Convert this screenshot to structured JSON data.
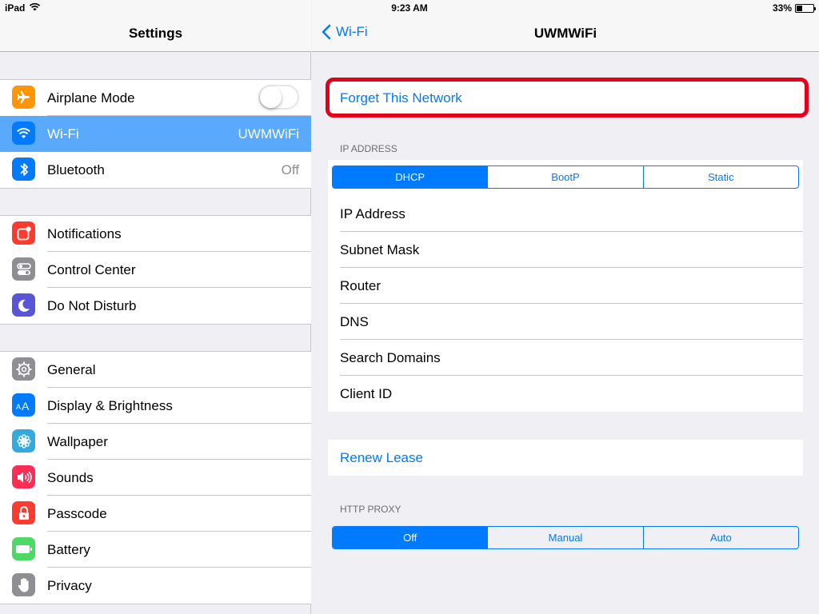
{
  "status": {
    "device": "iPad",
    "time": "9:23 AM",
    "battery_pct": "33%",
    "battery_level": 0.33
  },
  "left": {
    "title": "Settings",
    "groups": [
      [
        {
          "label": "Airplane Mode",
          "toggle": false,
          "icon": "airplane-icon",
          "color": "#ff9500"
        },
        {
          "label": "Wi-Fi",
          "value": "UWMWiFi",
          "icon": "wifi-icon",
          "color": "#007aff",
          "selected": true
        },
        {
          "label": "Bluetooth",
          "value": "Off",
          "icon": "bluetooth-icon",
          "color": "#007aff"
        }
      ],
      [
        {
          "label": "Notifications",
          "icon": "notifications-icon",
          "color": "#ff3b30"
        },
        {
          "label": "Control Center",
          "icon": "control-center-icon",
          "color": "#8e8e93"
        },
        {
          "label": "Do Not Disturb",
          "icon": "moon-icon",
          "color": "#5856d6"
        }
      ],
      [
        {
          "label": "General",
          "icon": "gear-icon",
          "color": "#8e8e93"
        },
        {
          "label": "Display & Brightness",
          "icon": "display-icon",
          "color": "#007aff"
        },
        {
          "label": "Wallpaper",
          "icon": "wallpaper-icon",
          "color": "#34aadc"
        },
        {
          "label": "Sounds",
          "icon": "speaker-icon",
          "color": "#ff2d55"
        },
        {
          "label": "Passcode",
          "icon": "lock-icon",
          "color": "#ff3b30"
        },
        {
          "label": "Battery",
          "icon": "battery-icon",
          "color": "#4cd964"
        },
        {
          "label": "Privacy",
          "icon": "hand-icon",
          "color": "#8e8e93"
        }
      ]
    ]
  },
  "right": {
    "back_label": "Wi-Fi",
    "title": "UWMWiFi",
    "forget": "Forget This Network",
    "ip_section": "IP ADDRESS",
    "ip_segments": [
      "DHCP",
      "BootP",
      "Static"
    ],
    "ip_active": 0,
    "ip_rows": [
      "IP Address",
      "Subnet Mask",
      "Router",
      "DNS",
      "Search Domains",
      "Client ID"
    ],
    "renew": "Renew Lease",
    "proxy_section": "HTTP PROXY",
    "proxy_segments": [
      "Off",
      "Manual",
      "Auto"
    ],
    "proxy_active": 0
  },
  "colors": {
    "accent": "#007aff",
    "selected_row": "#59a9fd",
    "highlight": "#e2001a"
  }
}
